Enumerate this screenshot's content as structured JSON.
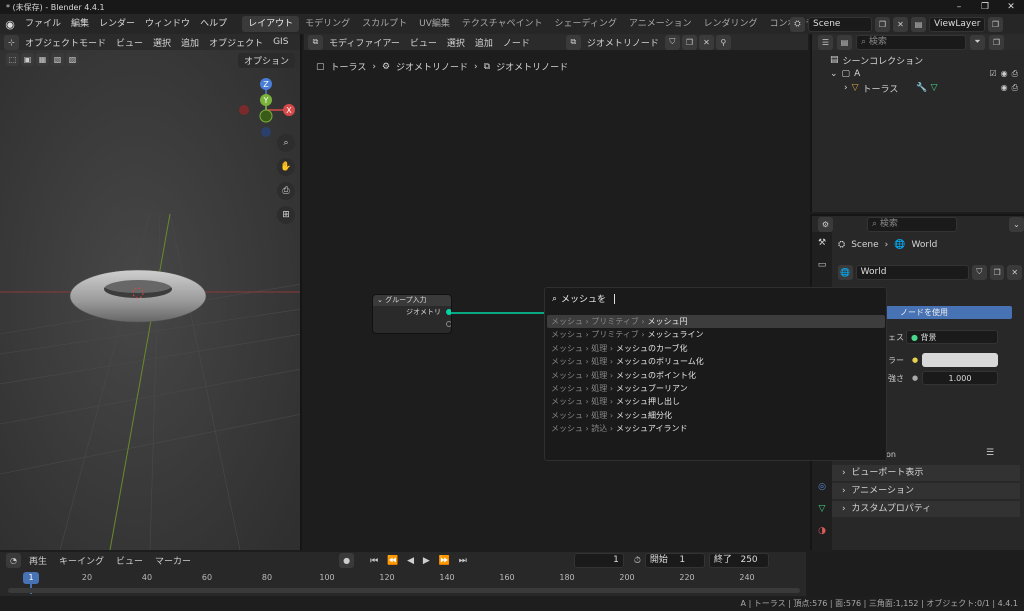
{
  "window": {
    "title": "* (未保存) - Blender 4.4.1"
  },
  "menu": [
    "ファイル",
    "編集",
    "レンダー",
    "ウィンドウ",
    "ヘルプ"
  ],
  "workspaces": [
    "レイアウト",
    "モデリング",
    "スカルプト",
    "UV編集",
    "テクスチャペイント",
    "シェーディング",
    "アニメーション",
    "レンダリング",
    "コンポジティング"
  ],
  "scene": {
    "name": "Scene",
    "view_layer": "ViewLayer"
  },
  "viewport3d": {
    "header": [
      "オブジェクトモード",
      "ビュー",
      "選択",
      "追加",
      "オブジェクト",
      "GIS"
    ],
    "options": "オプション",
    "gizmo": {
      "x": "X",
      "y": "Y",
      "z": "Z"
    }
  },
  "node_editor": {
    "header": [
      "モディファイアー",
      "ビュー",
      "選択",
      "追加",
      "ノード"
    ],
    "tree_name": "ジオメトリノード",
    "breadcrumb": [
      "トーラス",
      "ジオメトリノード",
      "ジオメトリノード"
    ],
    "node": {
      "title": "グループ入力",
      "socket": "ジオメトリ"
    }
  },
  "search": {
    "query": "メッシュを",
    "results": [
      {
        "cat": "メッシュ › プリミティブ ›",
        "name": "メッシュ円"
      },
      {
        "cat": "メッシュ › プリミティブ ›",
        "name": "メッシュライン"
      },
      {
        "cat": "メッシュ › 処理 ›",
        "name": "メッシュのカーブ化"
      },
      {
        "cat": "メッシュ › 処理 ›",
        "name": "メッシュのボリューム化"
      },
      {
        "cat": "メッシュ › 処理 ›",
        "name": "メッシュのポイント化"
      },
      {
        "cat": "メッシュ › 処理 ›",
        "name": "メッシュブーリアン"
      },
      {
        "cat": "メッシュ › 処理 ›",
        "name": "メッシュ押し出し"
      },
      {
        "cat": "メッシュ › 処理 ›",
        "name": "メッシュ細分化"
      },
      {
        "cat": "メッシュ › 読込 ›",
        "name": "メッシュアイランド"
      }
    ]
  },
  "outliner": {
    "search_placeholder": "検索",
    "root": "シーンコレクション",
    "collection": "A",
    "object": "トーラス"
  },
  "properties": {
    "search_placeholder": "検索",
    "crumb": [
      "Scene",
      "World"
    ],
    "world_name": "World",
    "use_nodes": "ノードを使用",
    "surface_value": "背景",
    "strength_value": "1.000",
    "panels": [
      "ビューポート表示",
      "アニメーション",
      "カスタムプロパティ"
    ],
    "partials": [
      "ェス",
      "ラー",
      "強さ",
      "on"
    ]
  },
  "timeline": {
    "header": [
      "再生",
      "キーイング",
      "ビュー",
      "マーカー"
    ],
    "current_frame": "1",
    "start_label": "開始",
    "start": "1",
    "end_label": "終了",
    "end": "250",
    "ticks": [
      "20",
      "40",
      "60",
      "80",
      "100",
      "120",
      "140",
      "160",
      "180",
      "200",
      "220",
      "240"
    ]
  },
  "status": "A | トーラス | 頂点:576 | 面:576 | 三角面:1,152 | オブジェクト:0/1 | 4.4.1"
}
